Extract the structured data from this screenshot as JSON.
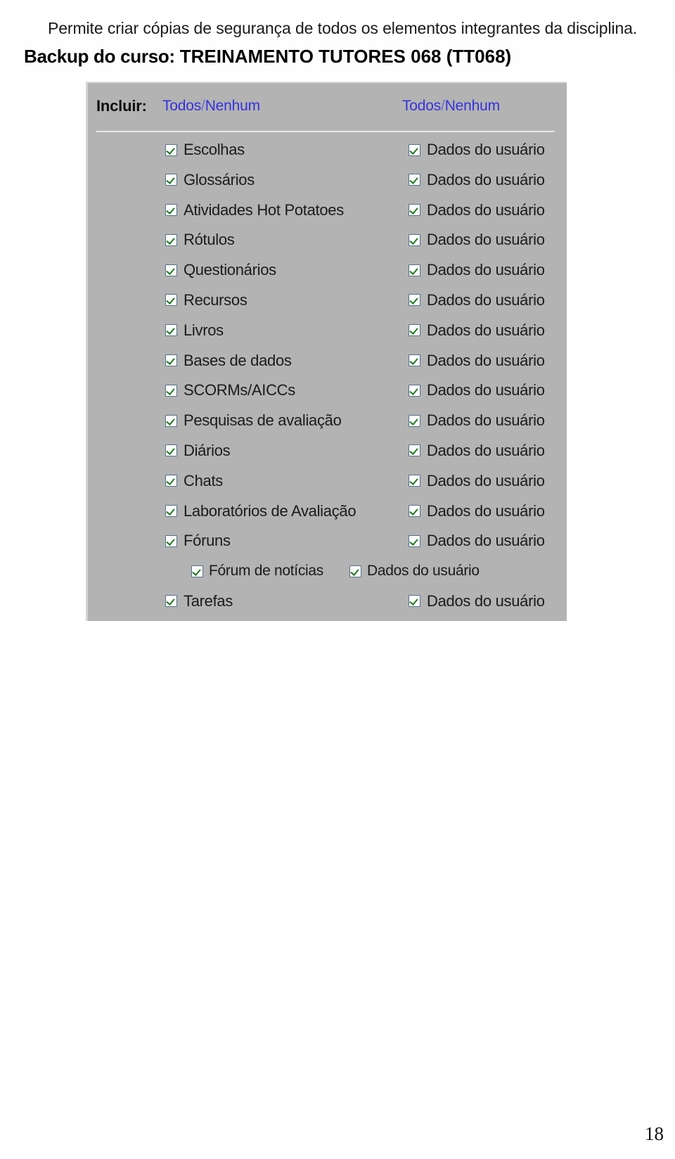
{
  "document": {
    "intro_paragraph": "Permite criar cópias de segurança de todos os elementos integrantes da disciplina.",
    "page_number": "18"
  },
  "screenshot": {
    "title_prefix": "Backup do curso:",
    "title_course": "TREINAMENTO TUTORES 068 (TT068)",
    "panel": {
      "include_label": "Incluir:",
      "all_none_left": "Todos/Nenhum",
      "all_none_right": "Todos/Nenhum",
      "user_data_label": "Dados do usuário",
      "rows": [
        {
          "label": "Escolhas",
          "checked": true,
          "user_data": "Dados do usuário",
          "user_data_checked": true,
          "sub": false
        },
        {
          "label": "Glossários",
          "checked": true,
          "user_data": "Dados do usuário",
          "user_data_checked": true,
          "sub": false
        },
        {
          "label": "Atividades Hot Potatoes",
          "checked": true,
          "user_data": "Dados do usuário",
          "user_data_checked": true,
          "sub": false
        },
        {
          "label": "Rótulos",
          "checked": true,
          "user_data": "Dados do usuário",
          "user_data_checked": true,
          "sub": false
        },
        {
          "label": "Questionários",
          "checked": true,
          "user_data": "Dados do usuário",
          "user_data_checked": true,
          "sub": false
        },
        {
          "label": "Recursos",
          "checked": true,
          "user_data": "Dados do usuário",
          "user_data_checked": true,
          "sub": false
        },
        {
          "label": "Livros",
          "checked": true,
          "user_data": "Dados do usuário",
          "user_data_checked": true,
          "sub": false
        },
        {
          "label": "Bases de dados",
          "checked": true,
          "user_data": "Dados do usuário",
          "user_data_checked": true,
          "sub": false
        },
        {
          "label": "SCORMs/AICCs",
          "checked": true,
          "user_data": "Dados do usuário",
          "user_data_checked": true,
          "sub": false
        },
        {
          "label": "Pesquisas de avaliação",
          "checked": true,
          "user_data": "Dados do usuário",
          "user_data_checked": true,
          "sub": false
        },
        {
          "label": "Diários",
          "checked": true,
          "user_data": "Dados do usuário",
          "user_data_checked": true,
          "sub": false
        },
        {
          "label": "Chats",
          "checked": true,
          "user_data": "Dados do usuário",
          "user_data_checked": true,
          "sub": false
        },
        {
          "label": "Laboratórios de Avaliação",
          "checked": true,
          "user_data": "Dados do usuário",
          "user_data_checked": true,
          "sub": false
        },
        {
          "label": "Fóruns",
          "checked": true,
          "user_data": "Dados do usuário",
          "user_data_checked": true,
          "sub": false
        },
        {
          "label": "Fórum de notícias",
          "checked": true,
          "user_data": "Dados do usuário",
          "user_data_checked": true,
          "sub": true
        },
        {
          "label": "Tarefas",
          "checked": true,
          "user_data": "Dados do usuário",
          "user_data_checked": true,
          "sub": false
        }
      ]
    }
  },
  "colors": {
    "panel_background": "#b3b3b3",
    "link_blue": "#3333dd",
    "check_green": "#1f7a1f",
    "checkbox_border": "#55708c",
    "page_background": "#ffffff"
  }
}
